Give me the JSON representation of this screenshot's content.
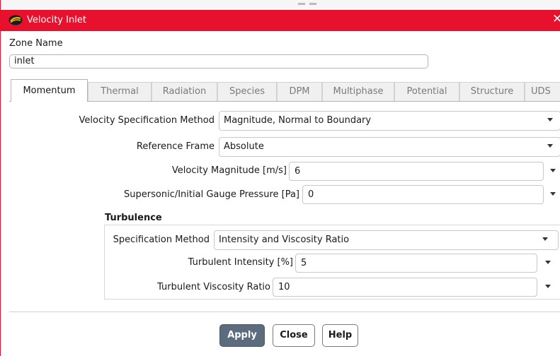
{
  "window": {
    "title": "Velocity Inlet",
    "close_glyph": "✕",
    "accent_color": "#e8112d",
    "app_icon": "ansys-fluent-icon"
  },
  "zone": {
    "label": "Zone Name",
    "value": "inlet"
  },
  "tabs": [
    {
      "label": "Momentum",
      "active": true
    },
    {
      "label": "Thermal",
      "active": false
    },
    {
      "label": "Radiation",
      "active": false
    },
    {
      "label": "Species",
      "active": false
    },
    {
      "label": "DPM",
      "active": false
    },
    {
      "label": "Multiphase",
      "active": false
    },
    {
      "label": "Potential",
      "active": false
    },
    {
      "label": "Structure",
      "active": false
    },
    {
      "label": "UDS",
      "active": false
    }
  ],
  "momentum": {
    "velocity_spec": {
      "label": "Velocity Specification Method",
      "value": "Magnitude, Normal to Boundary"
    },
    "reference_frame": {
      "label": "Reference Frame",
      "value": "Absolute"
    },
    "velocity_magnitude": {
      "label": "Velocity Magnitude [m/s]",
      "value": "6"
    },
    "gauge_pressure": {
      "label": "Supersonic/Initial Gauge Pressure [Pa]",
      "value": "0"
    }
  },
  "turbulence": {
    "title": "Turbulence",
    "spec_method": {
      "label": "Specification Method",
      "value": "Intensity and Viscosity Ratio"
    },
    "intensity": {
      "label": "Turbulent Intensity [%]",
      "value": "5"
    },
    "viscosity_ratio": {
      "label": "Turbulent Viscosity Ratio",
      "value": "10"
    }
  },
  "buttons": {
    "apply": "Apply",
    "close": "Close",
    "help": "Help"
  }
}
